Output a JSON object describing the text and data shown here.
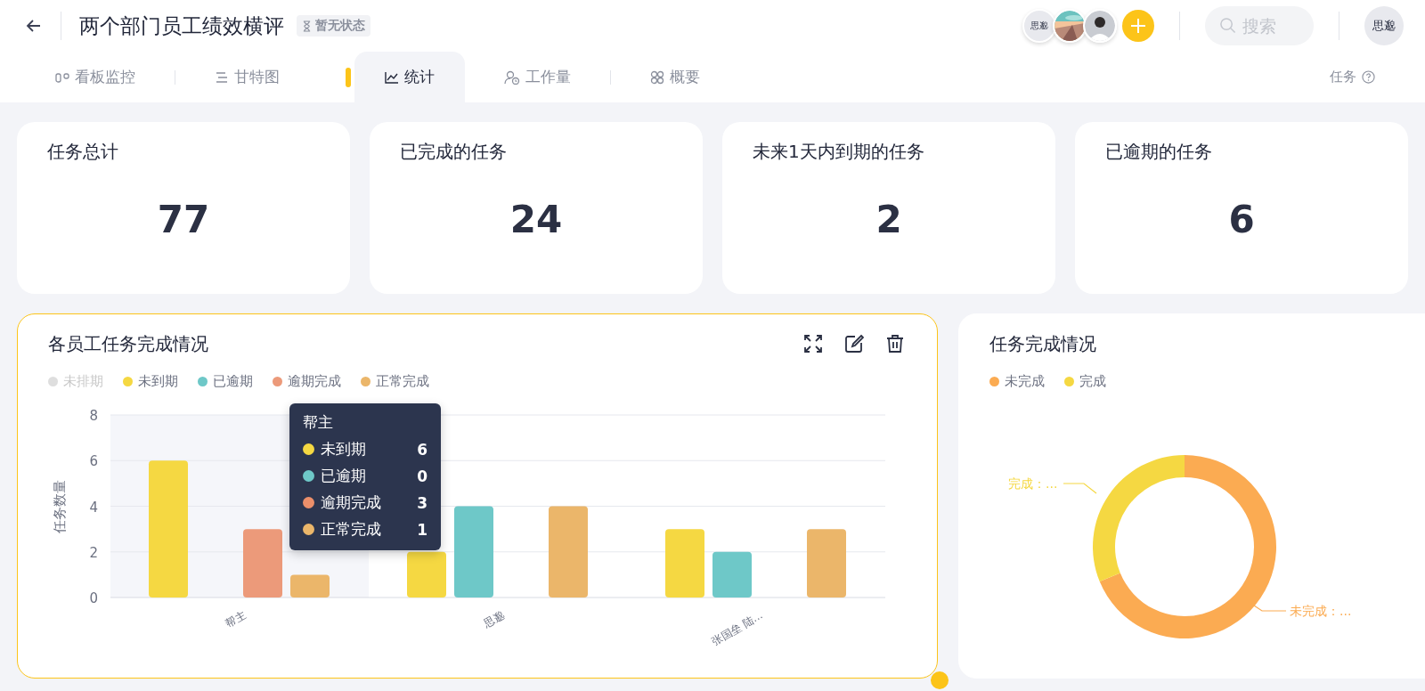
{
  "header": {
    "title": "两个部门员工绩效横评",
    "status": "暂无状态",
    "member_avatar_text": "思邈",
    "search": {
      "placeholder": "搜索"
    },
    "user_avatar_text": "思邈"
  },
  "tabs": [
    {
      "label": "看板监控",
      "selected": false
    },
    {
      "label": "甘特图",
      "selected": false
    },
    {
      "label": "统计",
      "selected": true
    },
    {
      "label": "工作量",
      "selected": false
    },
    {
      "label": "概要",
      "selected": false
    }
  ],
  "tabs_right": {
    "label": "任务"
  },
  "stats": [
    {
      "title": "任务总计",
      "value": "77"
    },
    {
      "title": "已完成的任务",
      "value": "24"
    },
    {
      "title": "未来1天内到期的任务",
      "value": "2"
    },
    {
      "title": "已逾期的任务",
      "value": "6"
    }
  ],
  "bar_panel": {
    "title": "各员工任务完成情况",
    "selected": true,
    "legend": [
      {
        "selected": false
      },
      {
        "selected": true
      },
      {
        "selected": true
      },
      {
        "selected": true
      },
      {
        "selected": true
      }
    ],
    "chart_data": {
      "type": "bar",
      "ylabel": "任务数量",
      "categories": [
        "帮主",
        "思邈",
        "张国垒 陆..."
      ],
      "ylim": [
        0,
        8
      ],
      "yticks": [
        0,
        2,
        4,
        6,
        8
      ],
      "grid": true,
      "series": [
        {
          "name": "未排期",
          "color": "#c8c8c8",
          "values": [
            null,
            null,
            null
          ]
        },
        {
          "name": "未到期",
          "color": "#f5d842",
          "values": [
            6,
            2,
            3
          ]
        },
        {
          "name": "已逾期",
          "color": "#6ec8c8",
          "values": [
            0,
            4,
            2
          ]
        },
        {
          "name": "逾期完成",
          "color": "#ec9a7a",
          "values": [
            3,
            0,
            0
          ]
        },
        {
          "name": "正常完成",
          "color": "#ebb66a",
          "values": [
            1,
            4,
            3
          ]
        }
      ]
    },
    "tooltip": {
      "title": "帮主",
      "rows": [
        {
          "label": "未到期",
          "color": "#f5d842",
          "value": "6"
        },
        {
          "label": "已逾期",
          "color": "#6ec8c8",
          "value": "0"
        },
        {
          "label": "逾期完成",
          "color": "#ec8f6a",
          "value": "3"
        },
        {
          "label": "正常完成",
          "color": "#ebb66a",
          "value": "1"
        }
      ]
    }
  },
  "donut_panel": {
    "title": "任务完成情况",
    "legend": [
      {
        "color": "#fbab52"
      },
      {
        "color": "#f5d842"
      }
    ],
    "chart_data": {
      "type": "donut",
      "categories": [
        "未完成",
        "完成"
      ],
      "values": [
        68.8,
        31.2
      ]
    },
    "slice_labels": [
      "未完成：...",
      "完成：..."
    ]
  }
}
